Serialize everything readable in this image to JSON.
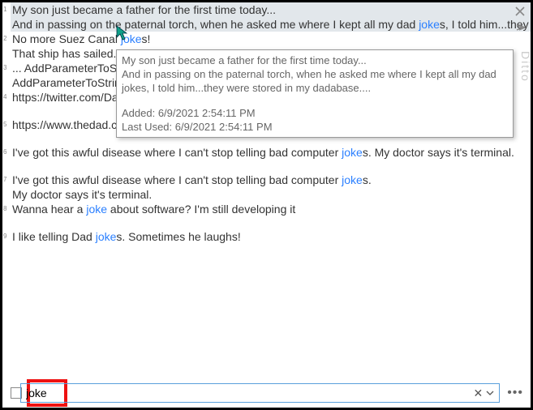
{
  "app_name": "Ditto",
  "search": {
    "value": "joke",
    "placeholder": ""
  },
  "entries": [
    {
      "num": "1",
      "lines": [
        {
          "pre": "My son just became a father for the first time today...",
          "hl": "",
          "post": ""
        },
        {
          "pre": "And in passing on the paternal torch, when he asked me where I kept all my dad ",
          "hl": "joke",
          "post": "s, I told him...they we"
        }
      ],
      "selected": true
    },
    {
      "num": "2",
      "lines": [
        {
          "pre": "No more Suez Canal ",
          "hl": "joke",
          "post": "s!"
        },
        {
          "pre": "That ship has sailed.",
          "hl": "",
          "post": ""
        }
      ]
    },
    {
      "num": "3",
      "lines": [
        {
          "pre": "... AddParameterToStr",
          "hl": "",
          "post": ""
        },
        {
          "pre": "AddParameterToStrin",
          "hl": "",
          "post": ""
        }
      ]
    },
    {
      "num": "4",
      "lines": [
        {
          "pre": "https://twitter.com/Da",
          "hl": "",
          "post": ""
        }
      ]
    },
    {
      "num": "5",
      "lines": [
        {
          "pre": "https://www.thedad.c",
          "hl": "",
          "post": ""
        }
      ]
    },
    {
      "num": "6",
      "lines": [
        {
          "pre": "I've got this awful disease where I can't stop telling bad computer ",
          "hl": "joke",
          "post": "s. My doctor says it's terminal."
        }
      ]
    },
    {
      "num": "7",
      "lines": [
        {
          "pre": "I've got this awful disease where I can't stop telling bad computer ",
          "hl": "joke",
          "post": "s."
        },
        {
          "pre": "My doctor says it's terminal.",
          "hl": "",
          "post": ""
        }
      ]
    },
    {
      "num": "8",
      "lines": [
        {
          "pre": "Wanna hear a ",
          "hl": "joke",
          "post": " about software? I'm still developing it"
        }
      ]
    },
    {
      "num": "9",
      "lines": [
        {
          "pre": "I like telling Dad ",
          "hl": "joke",
          "post": "s. Sometimes he laughs!"
        }
      ]
    }
  ],
  "gaps_before": [
    "5",
    "6",
    "7",
    "9"
  ],
  "tooltip": {
    "lines": [
      "My son just became a father for the first time today...",
      "And in passing on the paternal torch, when he asked me where I kept all my dad jokes, I told him...they were stored in my dadabase...."
    ],
    "added_label": "Added:",
    "added_value": "6/9/2021 2:54:11 PM",
    "lastused_label": "Last Used:",
    "lastused_value": "6/9/2021 2:54:11 PM"
  }
}
